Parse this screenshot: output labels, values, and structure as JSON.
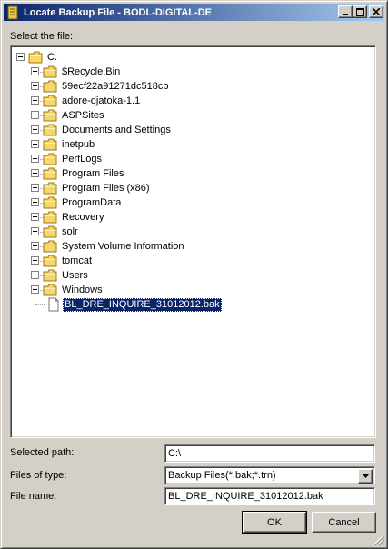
{
  "window": {
    "title": "Locate Backup File - BODL-DIGITAL-DE"
  },
  "labels": {
    "select_file": "Select the file:",
    "selected_path": "Selected path:",
    "files_of_type": "Files of type:",
    "file_name": "File name:"
  },
  "tree": {
    "root": "C:",
    "folders": [
      "$Recycle.Bin",
      "59ecf22a91271dc518cb",
      "adore-djatoka-1.1",
      "ASPSites",
      "Documents and Settings",
      "inetpub",
      "PerfLogs",
      "Program Files",
      "Program Files (x86)",
      "ProgramData",
      "Recovery",
      "solr",
      "System Volume Information",
      "tomcat",
      "Users",
      "Windows"
    ],
    "file": "BL_DRE_INQUIRE_31012012.bak"
  },
  "fields": {
    "selected_path": "C:\\",
    "files_of_type": "Backup Files(*.bak;*.trn)",
    "file_name": "BL_DRE_INQUIRE_31012012.bak"
  },
  "buttons": {
    "ok": "OK",
    "cancel": "Cancel"
  },
  "colors": {
    "titlebar_start": "#0a246a",
    "titlebar_end": "#a6caf0",
    "dialog_face": "#d4d0c8",
    "selection": "#0a246a",
    "folder": "#f5d76e"
  }
}
